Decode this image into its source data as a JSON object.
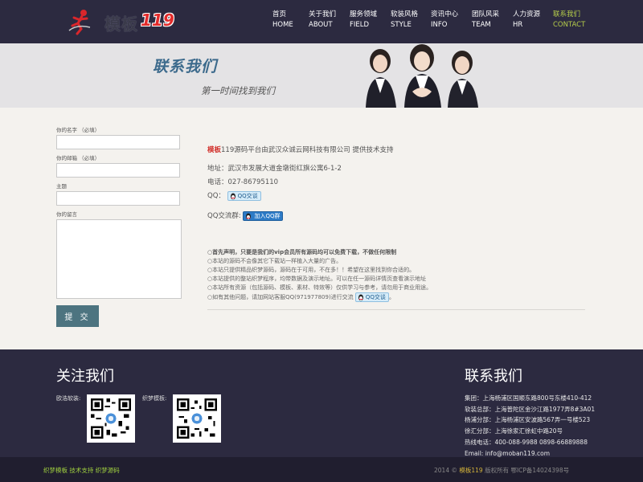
{
  "header": {
    "logo_text": "模板",
    "logo_number": "119",
    "nav": [
      {
        "cn": "首页",
        "en": "HOME"
      },
      {
        "cn": "关于我们",
        "en": "ABOUT"
      },
      {
        "cn": "服务领域",
        "en": "FIELD"
      },
      {
        "cn": "软装风格",
        "en": "STYLE"
      },
      {
        "cn": "资讯中心",
        "en": "INFO"
      },
      {
        "cn": "团队风采",
        "en": "TEAM"
      },
      {
        "cn": "人力资源",
        "en": "HR"
      },
      {
        "cn": "联系我们",
        "en": "CONTACT"
      }
    ],
    "active_nav": "CONTACT",
    "accent_color": "#b5cc4a"
  },
  "banner": {
    "title": "联系我们",
    "subtitle": "第一时间找到我们"
  },
  "form": {
    "name_label": "你的名字 （必填）",
    "email_label": "你的邮箱 （必填）",
    "subject_label": "主题",
    "message_label": "你的留言",
    "name_value": "",
    "email_value": "",
    "subject_value": "",
    "message_value": "",
    "submit_label": "提 交"
  },
  "info": {
    "brand": "模板",
    "provider_text": "119源码平台由武汉众诚云网科技有限公司 提供技术支持",
    "address": "地址：武汉市发展大道金墩街红旗公寓6-1-2",
    "phone": "电话：027-86795110",
    "qq_label": "QQ：",
    "qq_button": "QQ交谈",
    "qq_group_label": "QQ交流群:",
    "qq_group_button": "加入QQ群"
  },
  "notes": [
    "○首先声明，只要是我们的vip会员所有源码均可以免费下载，不做任何限制",
    "○本站的源码不会像其它下载站一样植入大量的广告。",
    "○本站只提供精品织梦源码，源码在于可用，不在多！！希望在这里找到你合适的。",
    "○本站提供的整站织梦程序，均带数据及演示地址。可以在任一源码详情页查看演示地址",
    "○本站所有资源（包括源码、模板、素材、特效等）仅供学习与参考，请勿用于商业用途。",
    "○如有其他问题，请加网站客服QQ(971977809)进行交流"
  ],
  "footer": {
    "follow_title": "关注我们",
    "qr1_label": "欧浩软装:",
    "qr2_label": "织梦模板:",
    "contact_title": "联系我们",
    "contacts": [
      "集团：上海杨浦区国顺东路800号东楼410-412",
      "软装总部：上海普陀区金沙江路1977弄8#3A01",
      "杨浦分部：上海杨浦区安波路567弄一号楼523",
      "徐汇分部：上海徐家汇徐虹中路20号",
      "热线电话：400-088-9988 0898-66889888",
      "Email: info@moban119.com"
    ]
  },
  "bottom": {
    "left_text": "织梦模板 技术支持 织梦源码",
    "right_prefix": "2014 © ",
    "right_brand": "模板119",
    "right_suffix": " 版权所有 鄂ICP备14024398号"
  }
}
